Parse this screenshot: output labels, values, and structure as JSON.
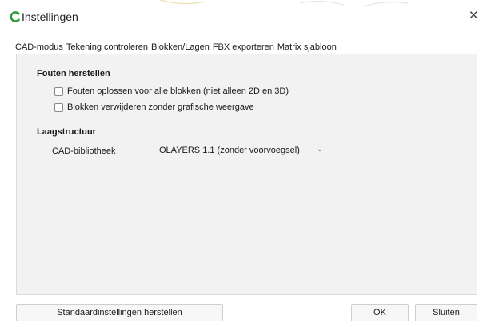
{
  "window": {
    "title": "Instellingen",
    "close_glyph": "✕"
  },
  "tabs": [
    {
      "label": "CAD-modus"
    },
    {
      "label": "Tekening controleren",
      "active": true
    },
    {
      "label": "Blokken/Lagen"
    },
    {
      "label": "FBX exporteren"
    },
    {
      "label": "Matrix sjabloon"
    }
  ],
  "sections": {
    "fouten": {
      "title": "Fouten herstellen",
      "options": [
        {
          "label": "Fouten oplossen voor alle blokken (niet alleen 2D en 3D)",
          "checked": false
        },
        {
          "label": "Blokken verwijderen zonder grafische weergave",
          "checked": false
        }
      ]
    },
    "laag": {
      "title": "Laagstructuur",
      "library_label": "CAD-bibliotheek",
      "library_value": "OLAYERS 1.1 (zonder voorvoegsel)"
    }
  },
  "buttons": {
    "reset": "Standaardinstellingen herstellen",
    "ok": "OK",
    "close": "Sluiten"
  },
  "colors": {
    "accent": "#2f9a3b",
    "panel": "#f2f2f2"
  },
  "icons": {
    "app": "app-logo-icon",
    "close": "close-icon",
    "dropdown": "chevron-down-icon"
  }
}
